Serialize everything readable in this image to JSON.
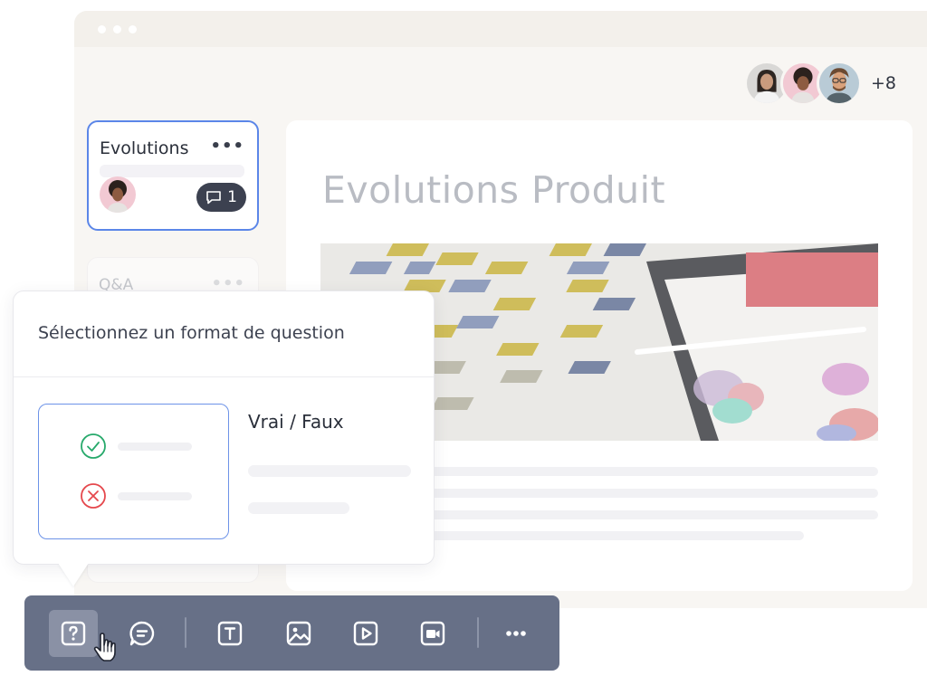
{
  "window": {
    "controls": [
      "close",
      "minimize",
      "maximize"
    ]
  },
  "collaborators": {
    "extra_count": "+8"
  },
  "sidebar": {
    "active_card": {
      "title": "Evolutions",
      "menu": "•••",
      "comment_count": "1"
    },
    "faded_card": {
      "title": "Q&A",
      "menu": "•••"
    }
  },
  "document": {
    "title": "Evolutions Produit"
  },
  "popup": {
    "title": "Sélectionnez un format de question",
    "format": {
      "name": "Vrai / Faux",
      "icons": [
        "check-circle-icon",
        "cross-circle-icon"
      ]
    }
  },
  "toolbar": {
    "tools": [
      "question-icon",
      "comment-icon",
      "text-icon",
      "image-icon",
      "video-play-icon",
      "camera-icon"
    ],
    "more": "•••"
  },
  "colors": {
    "accent": "#5b86e8",
    "toolbar": "#677087",
    "check": "#27a96b",
    "cross": "#e5484d"
  }
}
